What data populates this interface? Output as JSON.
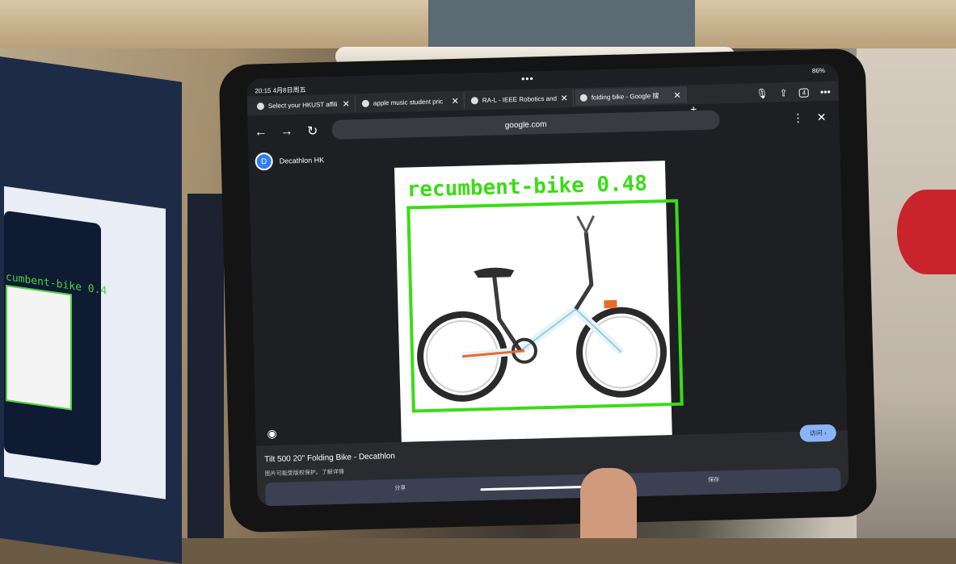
{
  "status": {
    "time": "20:15 4月8日周五",
    "battery": "86%"
  },
  "tabs": [
    {
      "title": "Select your HKUST affili",
      "active": false
    },
    {
      "title": "apple music student pric",
      "active": false
    },
    {
      "title": "RA-L - IEEE Robotics and",
      "active": false
    },
    {
      "title": "folding bike - Google 搜",
      "active": true
    }
  ],
  "toolbar": {
    "tab_count": "4"
  },
  "address_bar": {
    "url": "google.com"
  },
  "site": {
    "name": "Decathlon HK"
  },
  "detection": {
    "label": "recumbent-bike 0.48",
    "box_color": "#3adc16"
  },
  "caption": {
    "title": "Tilt 500 20\" Folding Bike - Decathlon",
    "subtitle": "图片可能受版权保护。了解详情",
    "visit_button": "访问 ›"
  },
  "bottom_bar": {
    "left": "分享",
    "right": "保存"
  },
  "background_monitor": {
    "label": "cumbent-bike 0.4"
  },
  "icons": {
    "back": "arrow-left-icon",
    "forward": "arrow-right-icon",
    "reload": "reload-icon",
    "mic": "microphone-icon",
    "share": "share-icon",
    "more": "more-icon",
    "close": "close-icon",
    "lens": "lens-icon"
  }
}
